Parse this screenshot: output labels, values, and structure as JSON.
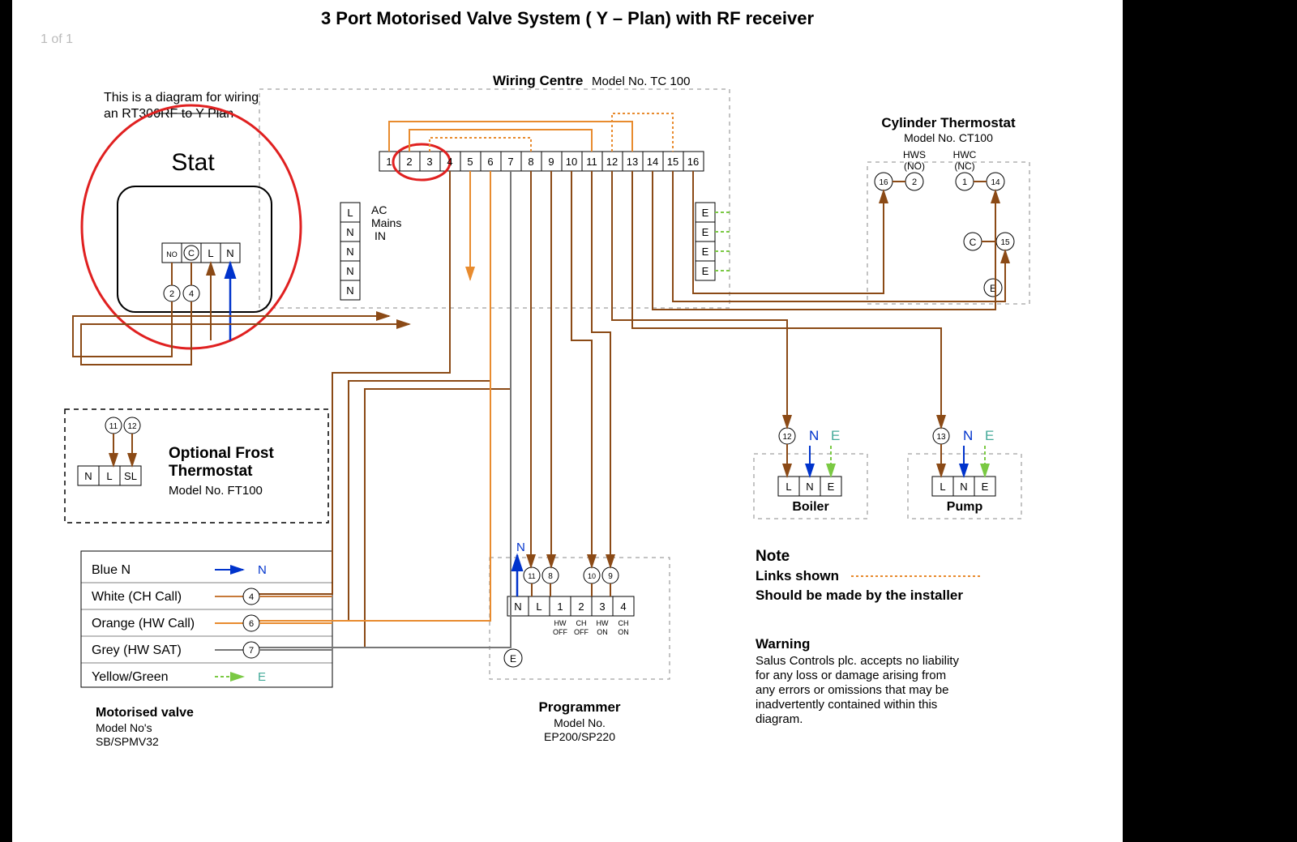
{
  "page_indicator": "1 of 1",
  "title": "3 Port Motorised Valve System ( Y – Plan) with RF receiver",
  "stat": {
    "intro1": "This is a diagram for wiring",
    "intro2": "an RT300RF to Y Plan",
    "label": "Stat",
    "terminals": [
      "NO",
      "C",
      "L",
      "N"
    ],
    "pins": [
      "2",
      "4"
    ]
  },
  "wiring_centre": {
    "heading": "Wiring Centre",
    "model": "Model No. TC 100",
    "terminals": [
      "1",
      "2",
      "3",
      "4",
      "5",
      "6",
      "7",
      "8",
      "9",
      "10",
      "11",
      "12",
      "13",
      "14",
      "15",
      "16"
    ],
    "ac_block": [
      "L",
      "N",
      "N",
      "N",
      "N"
    ],
    "ac_label1": "AC",
    "ac_label2": "Mains",
    "ac_label3": "IN",
    "earths": [
      "E",
      "E",
      "E",
      "E"
    ]
  },
  "cyl": {
    "heading": "Cylinder Thermostat",
    "model": "Model No. CT100",
    "hws": "HWS",
    "hws2": "(NO)",
    "hwc": "HWC",
    "hwc2": "(NC)",
    "pins": [
      "16",
      "2",
      "1",
      "14"
    ],
    "c_label": "C",
    "c_pin": "15",
    "e": "E"
  },
  "frost": {
    "heading": "Optional Frost",
    "heading2": "Thermostat",
    "model": "Model No. FT100",
    "terminals": [
      "N",
      "L",
      "SL"
    ],
    "pins": [
      "11",
      "12"
    ]
  },
  "mv": {
    "heading": "Motorised valve",
    "model1": "Model No's",
    "model2": "SB/SPMV32",
    "rows": [
      {
        "label": "Blue N",
        "pin": "",
        "end": "N",
        "color": "#0033cc"
      },
      {
        "label": "White (CH Call)",
        "pin": "4",
        "color": "#c77a3a"
      },
      {
        "label": "Orange (HW Call)",
        "pin": "6",
        "color": "#e88b2e"
      },
      {
        "label": "Grey (HW SAT)",
        "pin": "7",
        "color": "#777"
      },
      {
        "label": "Yellow/Green",
        "pin": "",
        "end": "E",
        "color": "#7ac943"
      }
    ]
  },
  "programmer": {
    "heading": "Programmer",
    "model1": "Model No.",
    "model2": "EP200/SP220",
    "terms": [
      "N",
      "L",
      "1",
      "2",
      "3",
      "4"
    ],
    "sub": [
      "HW",
      "CH",
      "HW",
      "CH"
    ],
    "sub2": [
      "OFF",
      "OFF",
      "ON",
      "ON"
    ],
    "n": "N",
    "e": "E",
    "pins": [
      "11",
      "8",
      "10",
      "9"
    ]
  },
  "boiler": {
    "heading": "Boiler",
    "terms": [
      "L",
      "N",
      "E"
    ],
    "pin": "12",
    "n": "N",
    "e": "E"
  },
  "pump": {
    "heading": "Pump",
    "terms": [
      "L",
      "N",
      "E"
    ],
    "pin": "13",
    "n": "N",
    "e": "E"
  },
  "note": {
    "h": "Note",
    "l1": "Links shown",
    "l2": "Should be made by the installer",
    "wh": "Warning",
    "w1": "Salus Controls plc. accepts no liability",
    "w2": "for any loss or damage arising from",
    "w3": "any errors or omissions that may be",
    "w4": "inadvertently contained within this",
    "w5": "diagram."
  }
}
